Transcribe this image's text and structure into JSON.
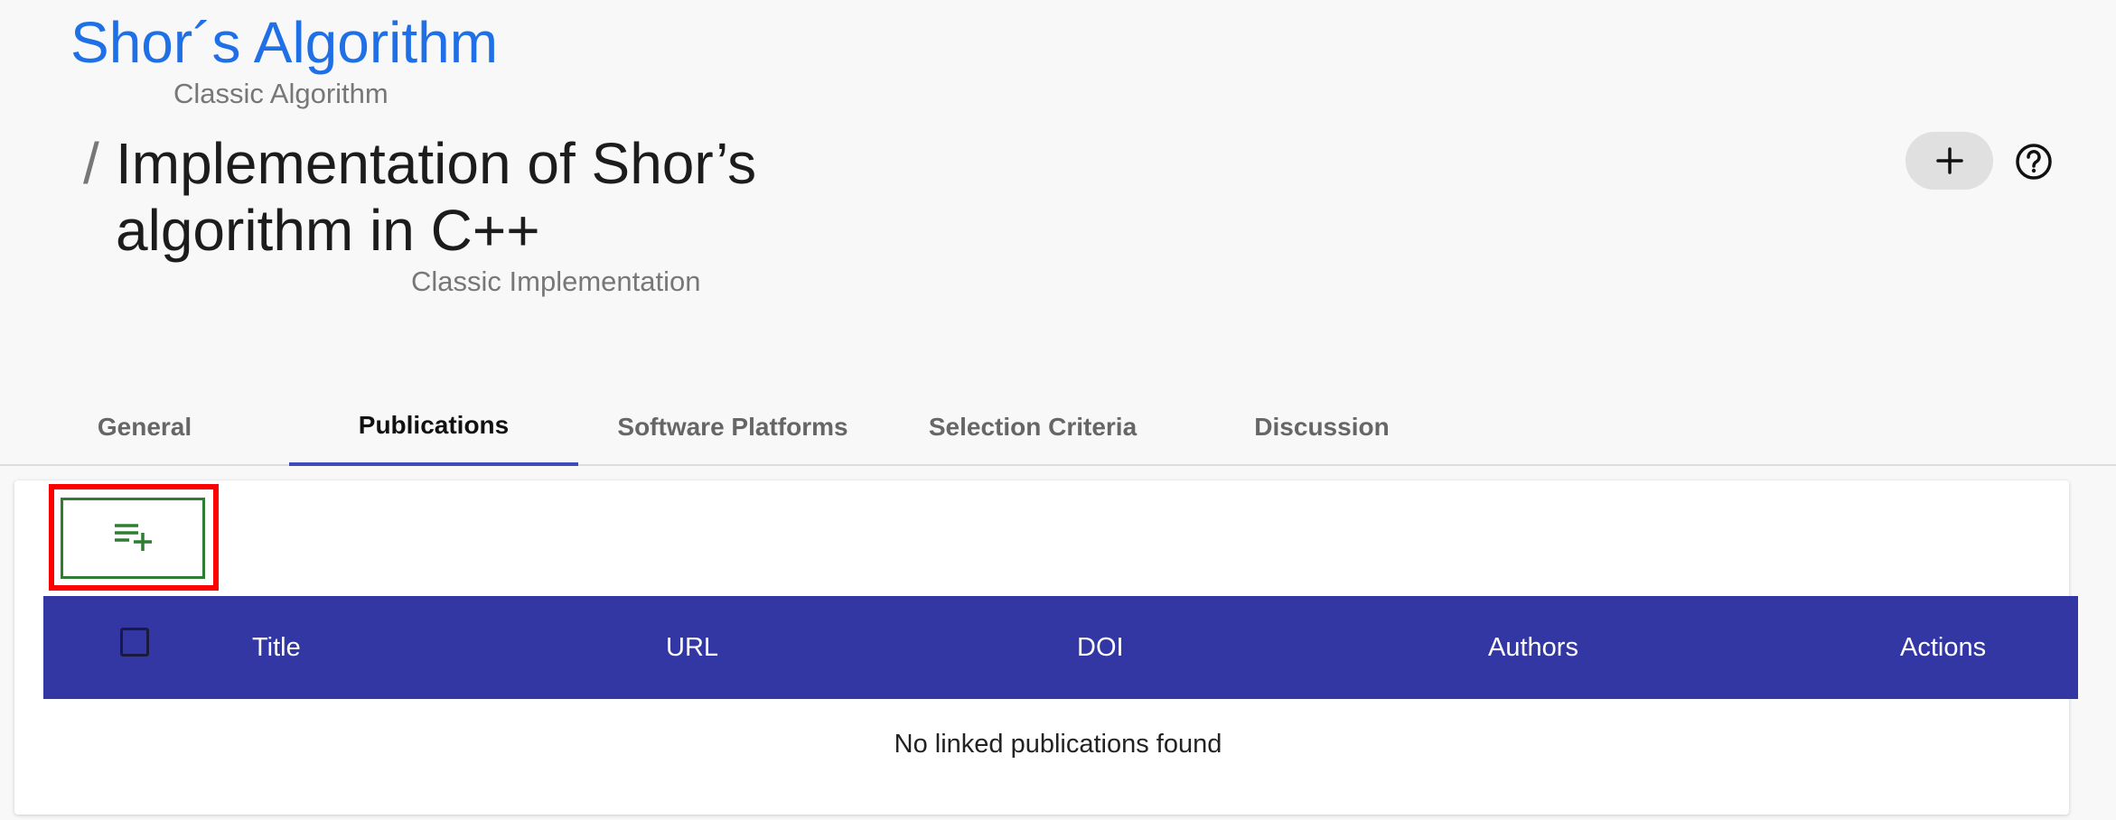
{
  "header": {
    "algorithm_title": "Shor´s Algorithm",
    "algorithm_subtitle": "Classic Algorithm",
    "separator": "/",
    "implementation_title": "Implementation of Shor’s algorithm in C++",
    "implementation_subtitle": "Classic Implementation"
  },
  "toolbar": {
    "add_icon": "plus-icon",
    "help_icon": "help-circle-icon"
  },
  "tabs": [
    {
      "label": "General",
      "active": false
    },
    {
      "label": "Publications",
      "active": true
    },
    {
      "label": "Software Platforms",
      "active": false
    },
    {
      "label": "Selection Criteria",
      "active": false
    },
    {
      "label": "Discussion",
      "active": false
    }
  ],
  "publications": {
    "add_button_icon": "playlist-add-icon",
    "columns": [
      "Title",
      "URL",
      "DOI",
      "Authors",
      "Actions"
    ],
    "empty_message": "No linked publications found"
  },
  "colors": {
    "accent_blue": "#1f6fe6",
    "table_header": "#3237a4",
    "add_button_green": "#2e7d32",
    "highlight_red": "#ff0000",
    "active_tab_underline": "#3f4bb8"
  }
}
